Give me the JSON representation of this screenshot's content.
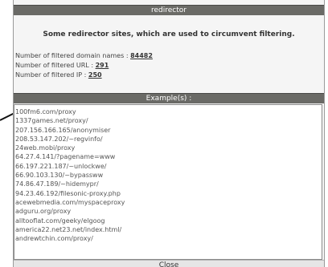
{
  "dialog": {
    "title": "redirector",
    "heading": "Some redirector sites, which are used to circumvent filtering.",
    "stats": [
      {
        "label": "Number of filtered domain names : ",
        "value": "84482"
      },
      {
        "label": "Number of filtered URL : ",
        "value": "291"
      },
      {
        "label": "Number of filtered IP : ",
        "value": "250"
      }
    ],
    "examples_title": "Example(s) :",
    "examples": [
      "100fm6.com/proxy",
      "1337games.net/proxy/",
      "207.156.166.165/anonymiser",
      "208.53.147.202/~regvinfo/",
      "24web.mobi/proxy",
      "64.27.4.141/?pagename=www",
      "66.197.221.187/~unlockwe/",
      "66.90.103.130/~bypassww",
      "74.86.47.189/~hidemypr/",
      "94.23.46.192/filesonic-proxy.php",
      "acewebmedia.com/myspaceproxy",
      "adguru.org/proxy",
      "alltooflat.com/geeky/elgoog",
      "america22.net23.net/index.html/",
      "andrewtchin.com/proxy/"
    ],
    "close_label": "Close"
  },
  "colors": {
    "title_bar": "#6a6a66",
    "panel_bg": "#f5f5f5"
  }
}
